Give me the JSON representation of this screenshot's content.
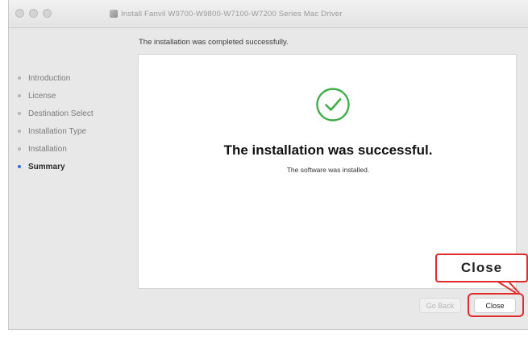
{
  "window": {
    "title": "Install Fanvil W9700-W9800-W7100-W7200 Series Mac Driver",
    "header_text": "The installation was completed successfully."
  },
  "sidebar": {
    "items": [
      {
        "label": "Introduction",
        "active": false
      },
      {
        "label": "License",
        "active": false
      },
      {
        "label": "Destination Select",
        "active": false
      },
      {
        "label": "Installation Type",
        "active": false
      },
      {
        "label": "Installation",
        "active": false
      },
      {
        "label": "Summary",
        "active": true
      }
    ]
  },
  "main": {
    "status_icon": "checkmark-circle-icon",
    "title": "The installation was successful.",
    "subtitle": "The software was installed."
  },
  "buttons": {
    "go_back": "Go Back",
    "close": "Close"
  },
  "annotation": {
    "callout_label": "Close",
    "highlight_color": "#e22b2b"
  },
  "colors": {
    "success_green": "#3fae49",
    "active_step": "#2f6fe0"
  }
}
